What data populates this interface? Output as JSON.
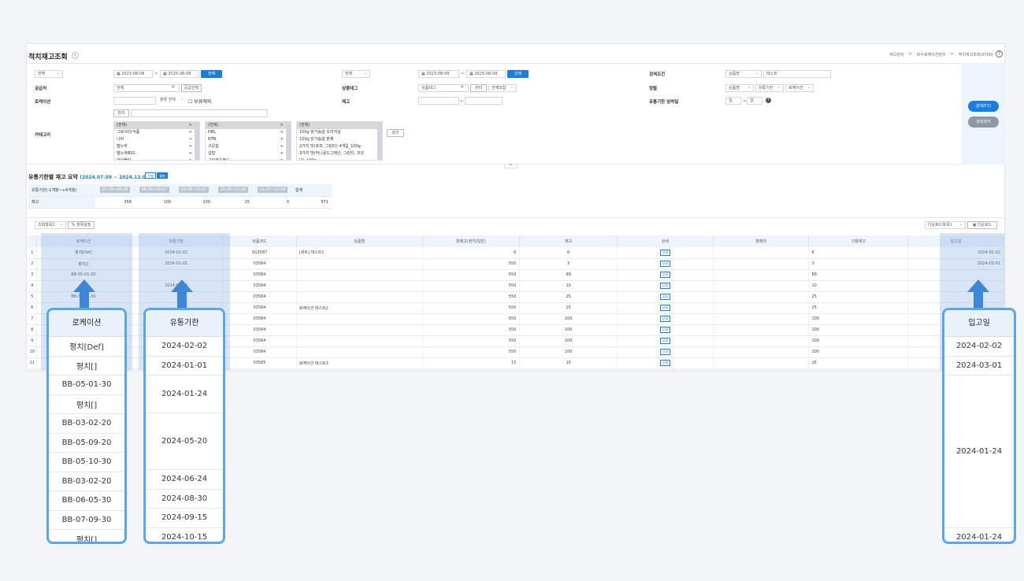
{
  "page": {
    "title": "적치재고조회",
    "breadcrumb": [
      "재고관리",
      ">",
      "피수로케이션관리",
      ">",
      "적치재고조회(0700)"
    ]
  },
  "search": {
    "row1": {
      "sel1": "전체",
      "date1": "2023-08-08",
      "date1_sep": "~",
      "date2": "2025-08-08",
      "btn1": "전체",
      "sel2": "전체",
      "date3": "2023-08-08",
      "date3_sep": "~",
      "date4": "2025-08-08",
      "btn2": "선택",
      "cond_label": "검색조건",
      "cond_sel": "상품명",
      "cond_value": "테스트"
    },
    "row2": {
      "supplier_label": "공급처",
      "supplier_value": "전체",
      "supplier_btn": "공급선택",
      "tag_label": "상품태그",
      "tag_placeholder": "상품태그",
      "tag_btn": "관리",
      "tag_sel": "전체포함",
      "sort_label": "정렬",
      "sort1": "상품명",
      "sort2": "유통기한",
      "sort3": "로케이션"
    },
    "row3": {
      "loc_label": "로케이션",
      "loc_sel": "분류 전체",
      "loc_check": "보류제외",
      "stock_label": "재고",
      "stock_sep": "~",
      "expiry_label": "유통기한 임박일",
      "expiry_v1": "일",
      "expiry_sep": "~",
      "expiry_v2": "일",
      "help": "?"
    },
    "row4": {
      "manage_btn": "관리"
    },
    "category": {
      "label": "카테고리",
      "manage_btn": "관리",
      "list1": [
        {
          "t": "(전체)",
          "a": ">"
        },
        {
          "t": "그로서리/식품",
          "a": ">"
        },
        {
          "t": "나비",
          "a": ">"
        },
        {
          "t": "델노바",
          "a": ">"
        },
        {
          "t": "델노바BSS",
          "a": ">"
        },
        {
          "t": "마이폴링",
          "a": ">"
        }
      ],
      "list2": [
        {
          "t": "(전체)",
          "a": ">"
        },
        {
          "t": "HBL",
          "a": ">"
        },
        {
          "t": "NTB",
          "a": ">"
        },
        {
          "t": "구운칩",
          "a": ">"
        },
        {
          "t": "김밥",
          "a": ">"
        },
        {
          "t": "그린라운푸드",
          "a": ">"
        }
      ],
      "list3": [
        {
          "t": "(전체)",
          "a": ""
        },
        {
          "t": "150g 닭가슴살 오리지널",
          "a": ""
        },
        {
          "t": "150g 닭가슴살 훈제",
          "a": ""
        },
        {
          "t": "2가지 맛(호프, 그린티) 4개입_100g",
          "a": ""
        },
        {
          "t": "3가지 맛(허니골드그레인, 그린티, 코코넛)_100g",
          "a": ""
        },
        {
          "t": "3가지 맛_6가지 맛(허니골드그레인)_100g",
          "a": ""
        }
      ]
    },
    "buttons": {
      "search": "검색(F2)",
      "reset": "검색관리"
    },
    "toggle": "^"
  },
  "summary": {
    "title": "유통기한별 재고 요약",
    "range": "(2024.07.09 ~ 2024.12.06)",
    "chip1": "주별",
    "chip2": "월별",
    "head": [
      "유통기한(-1개월~+4개월)",
      "07.09~08.08",
      "08.09~09.07",
      "09.08~10.07",
      "10.08~11.06",
      "11.07~12.06",
      "합계"
    ],
    "row": [
      "재고",
      "356",
      "100",
      "100",
      "15",
      "0",
      "571"
    ]
  },
  "toolbar": {
    "left_sel": "조회항목1",
    "left_btn": "항목설정",
    "right_sel": "다운로드항목1",
    "right_btn": "다운로드"
  },
  "grid": {
    "cols": [
      "",
      "로케이션",
      "유통기한",
      "상품코드",
      "상품명",
      "판매고(정지/일반)",
      "재고",
      "상세",
      "판매처",
      "가용재고",
      "입고일"
    ],
    "rows": [
      [
        "1",
        "평치[Def]",
        "2024-02-02",
        "SG3587",
        "[세트] 테스트1",
        "6",
        "6",
        "상세",
        "",
        "6",
        "2024-02-02"
      ],
      [
        "2",
        "평치[]",
        "2024-01-01",
        "03584",
        "",
        "550",
        "3",
        "상세",
        "",
        "3",
        "2024-03-01"
      ],
      [
        "3",
        "BB-05-01-30",
        "",
        "03584",
        "",
        "550",
        "89",
        "상세",
        "",
        "89",
        ""
      ],
      [
        "4",
        "",
        "2024-01-24",
        "03584",
        "",
        "550",
        "10",
        "상세",
        "",
        "10",
        ""
      ],
      [
        "5",
        "BB-05-01-30",
        "",
        "03584",
        "",
        "550",
        "25",
        "상세",
        "",
        "25",
        ""
      ],
      [
        "6",
        "",
        "",
        "03584",
        "로케이션 테스트2",
        "550",
        "25",
        "상세",
        "",
        "25",
        ""
      ],
      [
        "7",
        "",
        "",
        "03584",
        "",
        "550",
        "100",
        "상세",
        "",
        "100",
        ""
      ],
      [
        "8",
        "",
        "",
        "03584",
        "",
        "550",
        "100",
        "상세",
        "",
        "100",
        ""
      ],
      [
        "9",
        "",
        "",
        "03584",
        "",
        "550",
        "100",
        "상세",
        "",
        "100",
        ""
      ],
      [
        "10",
        "",
        "",
        "03584",
        "",
        "550",
        "100",
        "상세",
        "",
        "100",
        ""
      ],
      [
        "11",
        "",
        "",
        "03585",
        "로케이션 테스트3",
        "15",
        "15",
        "상세",
        "",
        "15",
        ""
      ]
    ]
  },
  "card_location": {
    "title": "로케이션",
    "items": [
      "평치[Def]",
      "평치[]",
      "BB-05-01-30",
      "평치[]",
      "BB-03-02-20",
      "BB-05-09-20",
      "BB-05-10-30",
      "BB-03-02-20",
      "BB-06-05-30",
      "BB-07-09-30",
      "평치[]"
    ]
  },
  "card_expiry": {
    "title": "유통기한",
    "items": [
      "2024-02-02",
      "2024-01-01",
      "2024-01-24",
      "2024-05-20",
      "2024-06-24",
      "2024-08-30",
      "2024-09-15",
      "2024-10-15"
    ]
  },
  "card_ingoing": {
    "title": "입고일",
    "items": [
      "2024-02-02",
      "2024-03-01",
      "2024-01-24",
      "2024-01-24"
    ]
  },
  "colors": {
    "accent": "#1a7de0",
    "card_border": "#5aa6ec",
    "highlight": "#8cb4e6"
  }
}
